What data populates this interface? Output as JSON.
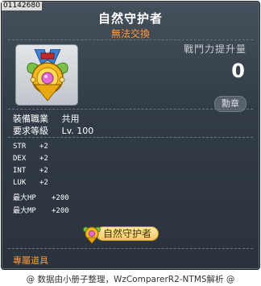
{
  "item_id": "01142680",
  "title": "自然守护者",
  "subtitle": "無法交換",
  "power": {
    "label": "戰鬥力提升量",
    "value": "0"
  },
  "badge_button": "勳章",
  "requirements": [
    {
      "label": "裝備職業",
      "value": "共用"
    },
    {
      "label": "要求等級",
      "value": "Lv. 100"
    }
  ],
  "stats": [
    {
      "label": "STR",
      "value": "+2"
    },
    {
      "label": "DEX",
      "value": "+2"
    },
    {
      "label": "INT",
      "value": "+2"
    },
    {
      "label": "LUK",
      "value": "+2"
    },
    {
      "label": "最大HP",
      "value": "+200"
    },
    {
      "label": "最大MP",
      "value": "+200"
    }
  ],
  "medal_tag": "自然守护者",
  "exclusive_label": "專屬道具",
  "footer": "@ 数据由小册子整理，WzComparerR2-NTMS解析 @",
  "colors": {
    "accent_orange": "#ff9a3c",
    "background": "#323c46",
    "medal_gold": "#f3c862"
  },
  "icons": {
    "item": "nature-guardian-medal-icon",
    "medal_tag": "medal-emblem-icon"
  }
}
